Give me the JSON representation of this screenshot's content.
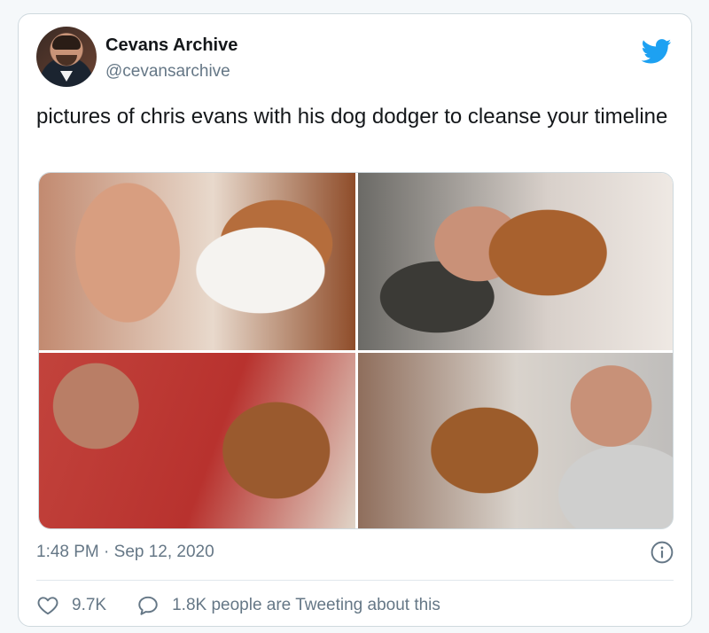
{
  "tweet": {
    "author_name": "Cevans Archive",
    "author_handle": "@cevansarchive",
    "text": "pictures of chris evans with his dog dodger to cleanse your timeline",
    "time": "1:48 PM · Sep 12, 2020",
    "likes": "9.7K",
    "conversation_text": "1.8K people are Tweeting about this"
  },
  "colors": {
    "brand_blue": "#1da1f2",
    "secondary_text": "#657786",
    "primary_text": "#14171a"
  },
  "icons": [
    "twitter-bird-icon",
    "info-icon",
    "heart-icon",
    "speech-bubble-icon"
  ]
}
